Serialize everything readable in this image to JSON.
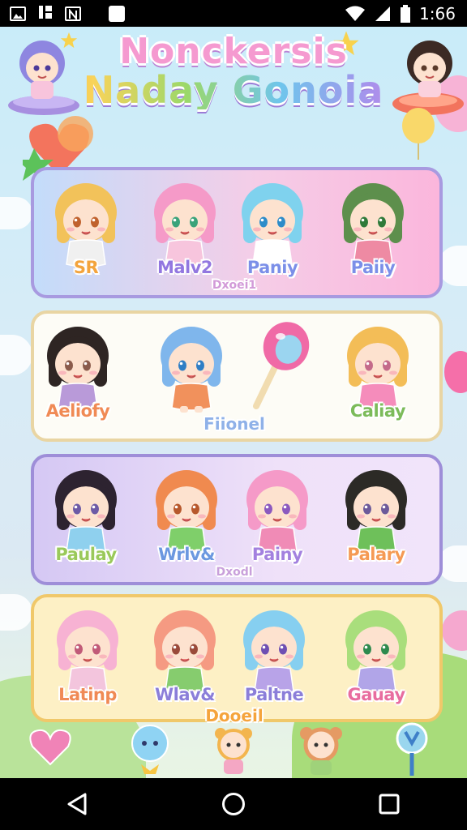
{
  "status_bar": {
    "time": "1:66",
    "left_icons": [
      "image-icon",
      "data-icon",
      "nfc-icon",
      "square-icon"
    ],
    "right_icons": [
      "wifi-icon",
      "signal-icon",
      "battery-icon"
    ]
  },
  "title": {
    "line1": "Nonckersis",
    "line2": "Naday Gonoia"
  },
  "rows": [
    {
      "characters": [
        {
          "label": "SR",
          "hair": "#f2c25a",
          "eye": "#c0622e",
          "shirt": "#f0f0f0",
          "label_color": "#f3a43d"
        },
        {
          "label": "Malv2",
          "hair": "#f59ac8",
          "eye": "#3aa37a",
          "shirt": "#f7c5dd",
          "label_color": "#9277e0"
        },
        {
          "label": "Paniy",
          "hair": "#7fd2ee",
          "eye": "#2d8cc9",
          "shirt": "#ffffff",
          "label_color": "#7b8fe8"
        },
        {
          "label": "Paiiy",
          "hair": "#5d8f4c",
          "eye": "#2f7a3a",
          "shirt": "#ee8aa3",
          "label_color": "#7b8fe8"
        }
      ],
      "subtitle": "Dxoei1",
      "subtitle_color": "#d29ad8"
    },
    {
      "characters": [
        {
          "label": "Aeliofy",
          "hair": "#2e2523",
          "eye": "#8a5b4b",
          "shirt": "#b99ad9",
          "label_color": "#f08a55"
        },
        {
          "label": "",
          "hair": "#7fb6ec",
          "eye": "#2f7ec5",
          "shirt": "#f1915c",
          "label_color": "#7aa3e6"
        },
        {
          "label": "Caliay",
          "hair": "#f3bd57",
          "eye": "#c46a8a",
          "shirt": "#f58cbb",
          "label_color": "#7cbb5a"
        }
      ],
      "subtitle": "Fiionel",
      "subtitle_color": "#8fb1e8"
    },
    {
      "characters": [
        {
          "label": "Paulay",
          "hair": "#2d2330",
          "eye": "#6d5aa6",
          "shirt": "#8fd0ee",
          "label_color": "#9ac95a"
        },
        {
          "label": "Wrlv&",
          "hair": "#f08a4f",
          "eye": "#b7582c",
          "shirt": "#7fcf6a",
          "label_color": "#6c98e0"
        },
        {
          "label": "Painy",
          "hair": "#f59ac8",
          "eye": "#8b59bf",
          "shirt": "#f08bb6",
          "label_color": "#a381df"
        },
        {
          "label": "Palary",
          "hair": "#2c2a26",
          "eye": "#6c5a9a",
          "shirt": "#6ec05a",
          "label_color": "#f59a54"
        }
      ],
      "subtitle": "Dxodl",
      "subtitle_color": "#c9a0db"
    },
    {
      "characters": [
        {
          "label": "Latinp",
          "hair": "#f7b2d3",
          "eye": "#c15a78",
          "shirt": "#f3c5dd",
          "label_color": "#f08a55"
        },
        {
          "label": "Wlav&",
          "hair": "#f59a82",
          "eye": "#9a4a3a",
          "shirt": "#86cc6e",
          "label_color": "#8b7ed9"
        },
        {
          "label": "Paltne",
          "hair": "#86cff0",
          "eye": "#6e4fb3",
          "shirt": "#b8a3e8",
          "label_color": "#8b7ed9"
        },
        {
          "label": "Gauay",
          "hair": "#a9de7c",
          "eye": "#2e8a4e",
          "shirt": "#b1a5e8",
          "label_color": "#e86d9f"
        }
      ],
      "subtitle": "Dooeil",
      "subtitle_color": "#f5a43c"
    }
  ],
  "bottom_items": [
    "heart-charm",
    "bubble-friend",
    "bear-friend-1",
    "bear-friend-2",
    "candy-wand"
  ],
  "nav": {
    "buttons": [
      "back",
      "home",
      "recents"
    ]
  },
  "colors": {
    "accent_pink": "#f59ad0",
    "accent_purple": "#a89ae0",
    "sky": "#c9ecf9"
  }
}
